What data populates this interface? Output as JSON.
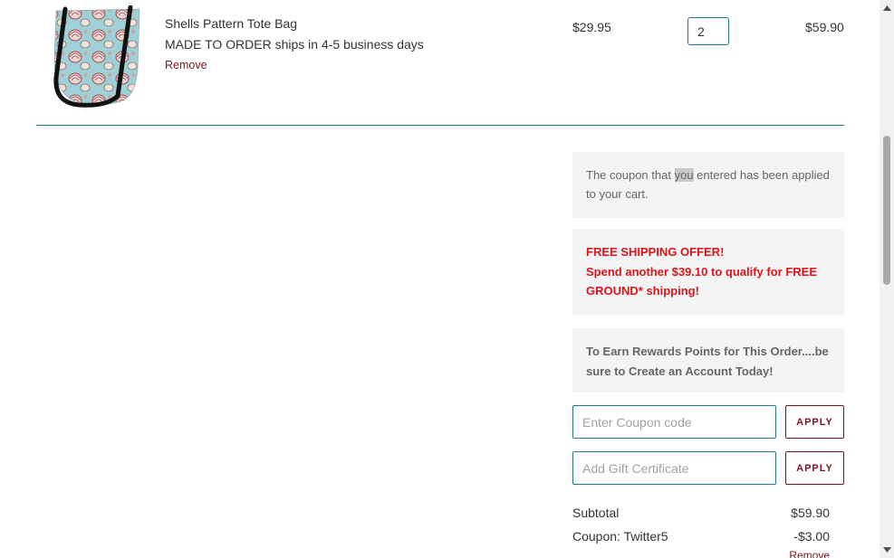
{
  "cart_item": {
    "name": "Shells Pattern Tote Bag",
    "note": "MADE TO ORDER ships in 4-5 business days",
    "remove_label": "Remove",
    "unit_price": "$29.95",
    "quantity": "2",
    "line_total": "$59.90",
    "image_alt": "Shells pattern tote bag product image"
  },
  "messages": {
    "coupon_applied_before": "The coupon that ",
    "coupon_applied_highlight": "you",
    "coupon_applied_after": " entered has been applied to your cart.",
    "shipping_line1": "FREE SHIPPING OFFER!",
    "shipping_line2": "Spend another $39.10 to qualify for FREE GROUND* shipping!",
    "rewards": "To Earn Rewards Points for This Order....be sure to Create an Account Today!"
  },
  "coupon": {
    "placeholder": "Enter Coupon code",
    "apply_label": "APPLY"
  },
  "gift": {
    "placeholder": "Add Gift Certificate",
    "apply_label": "APPLY"
  },
  "totals": {
    "subtotal_label": "Subtotal",
    "subtotal_value": "$59.90",
    "coupon_label": "Coupon: Twitter5",
    "coupon_value": "-$3.00",
    "coupon_remove": "Remove"
  },
  "colors": {
    "accent_teal": "#1c7c8c",
    "maroon": "#7a1420",
    "alert_red": "#e1131a"
  },
  "icons": [
    "tote-bag-image",
    "scroll-up-arrow-icon",
    "scroll-down-arrow-icon"
  ]
}
